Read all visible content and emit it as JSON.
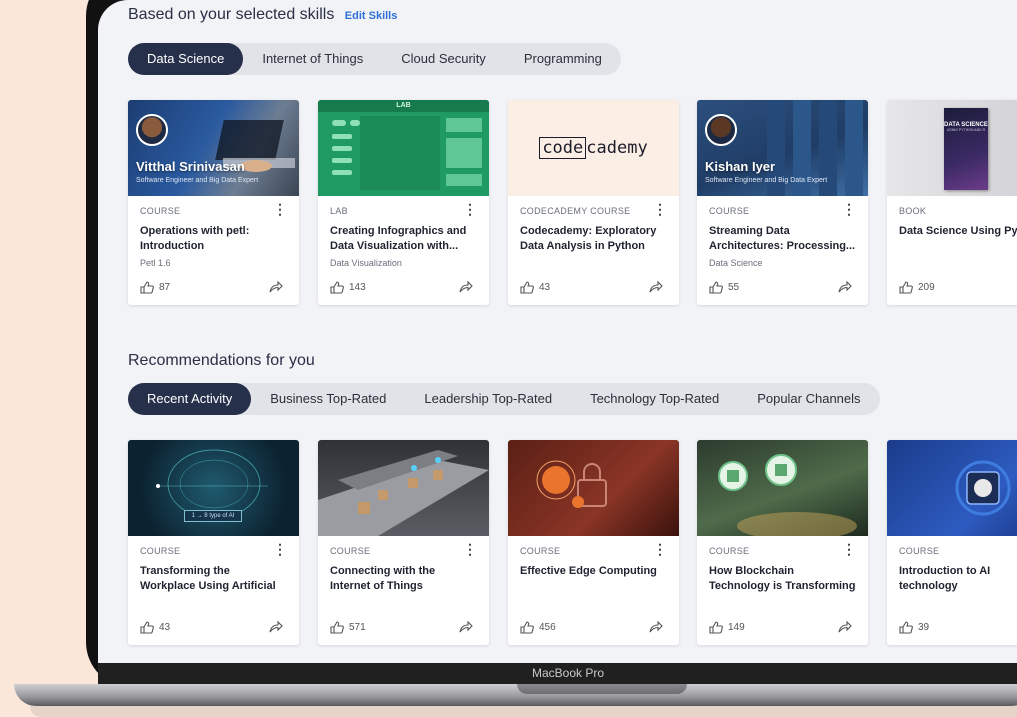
{
  "colors": {
    "accent": "#26304a",
    "link": "#2f6fd8",
    "page_bg": "#fbe7da"
  },
  "laptop": {
    "model_label": "MacBook Pro"
  },
  "skills": {
    "title": "Based on your selected skills",
    "edit_label": "Edit Skills",
    "tabs": [
      "Data Science",
      "Internet of Things",
      "Cloud Security",
      "Programming"
    ],
    "active_tab": "Data Science",
    "cards": [
      {
        "type": "COURSE",
        "title": "Operations with petl: Introduction",
        "subtitle": "Petl 1.6",
        "likes": "87",
        "thumb_name": "Vitthal Srinivasan",
        "thumb_role": "Software Engineer and Big Data Expert"
      },
      {
        "type": "LAB",
        "title": "Creating Infographics and Data Visualization with...",
        "subtitle": "Data Visualization",
        "likes": "143",
        "thumb_label": "LAB"
      },
      {
        "type": "CODECADEMY COURSE",
        "title": "Codecademy: Exploratory Data Analysis in Python",
        "subtitle": "",
        "likes": "43",
        "thumb_logo_a": "code",
        "thumb_logo_b": "cademy"
      },
      {
        "type": "COURSE",
        "title": "Streaming Data Architectures: Processing...",
        "subtitle": "Data Science",
        "likes": "55",
        "thumb_name": "Kishan Iyer",
        "thumb_role": "Software Engineer and Big Data Expert"
      },
      {
        "type": "BOOK",
        "title": "Data Science Using Pyth and R",
        "subtitle": "",
        "likes": "209",
        "thumb_book_title": "DATA SCIENCE",
        "thumb_book_sub": "USING PYTHON AND R"
      }
    ]
  },
  "recs": {
    "title": "Recommendations for you",
    "tabs": [
      "Recent Activity",
      "Business Top-Rated",
      "Leadership Top-Rated",
      "Technology Top-Rated",
      "Popular Channels"
    ],
    "active_tab": "Recent Activity",
    "cards": [
      {
        "type": "COURSE",
        "title": "Transforming the Workplace Using Artificial Intelligence",
        "likes": "43",
        "thumb_caption": "1 → 8 type of AI"
      },
      {
        "type": "COURSE",
        "title": "Connecting with the Internet of Things",
        "likes": "571"
      },
      {
        "type": "COURSE",
        "title": "Effective Edge Computing",
        "likes": "456"
      },
      {
        "type": "COURSE",
        "title": "How Blockchain Technology is Transforming Businesses",
        "likes": "149"
      },
      {
        "type": "COURSE",
        "title": "Introduction to AI technology",
        "likes": "39"
      }
    ]
  }
}
